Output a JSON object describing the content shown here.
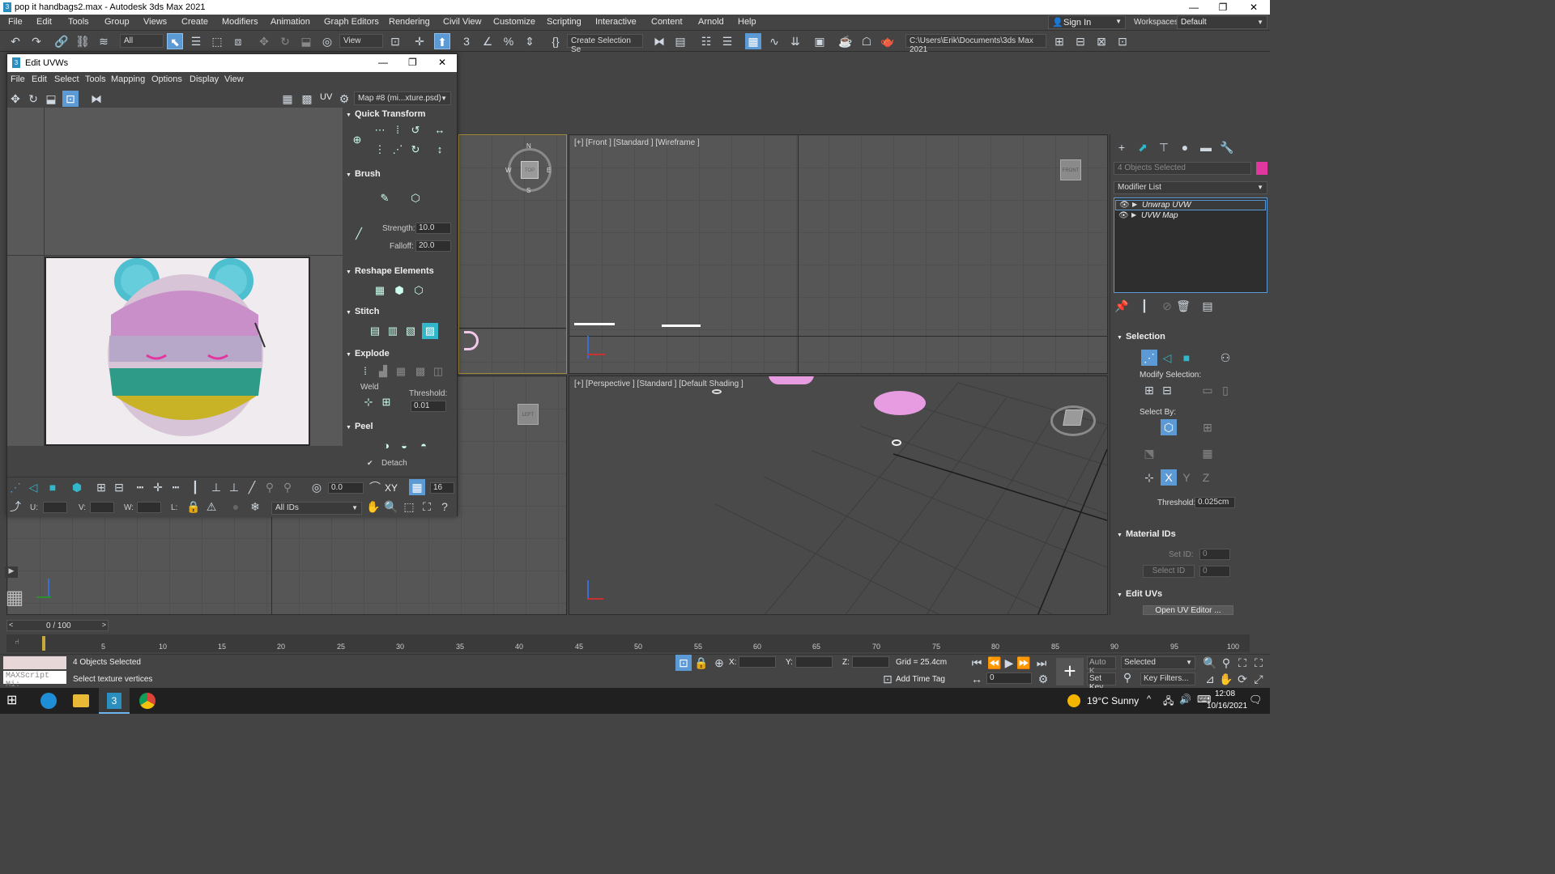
{
  "window": {
    "title": "pop it handbags2.max - Autodesk 3ds Max 2021",
    "icon": "3",
    "minimize": "—",
    "maximize": "❐",
    "close": "✕"
  },
  "menubar": {
    "items": [
      "File",
      "Edit",
      "Tools",
      "Group",
      "Views",
      "Create",
      "Modifiers",
      "Animation",
      "Graph Editors",
      "Rendering",
      "Civil View",
      "Customize",
      "Scripting",
      "Interactive",
      "Content",
      "Arnold",
      "Help"
    ],
    "sign_in": "Sign In",
    "workspaces_label": "Workspaces:",
    "workspaces_value": "Default"
  },
  "toolbar": {
    "filter_value": "All",
    "view_value": "View",
    "selection_set_value": "Create Selection Se",
    "path_value": "C:\\Users\\Erik\\Documents\\3ds Max 2021"
  },
  "uv_editor": {
    "title": "Edit UVWs",
    "icon": "3",
    "menu": [
      "File",
      "Edit",
      "Select",
      "Tools",
      "Mapping",
      "Options",
      "Display",
      "View"
    ],
    "uv_label": "UV",
    "map_dropdown": "Map #8 (mi...xture.psd)",
    "rollouts": {
      "quick_transform": "Quick Transform",
      "brush": "Brush",
      "strength_label": "Strength:",
      "strength_value": "10.0",
      "falloff_label": "Falloff:",
      "falloff_value": "20.0",
      "reshape": "Reshape Elements",
      "stitch": "Stitch",
      "explode": "Explode",
      "weld_label": "Weld",
      "threshold_label": "Threshold:",
      "threshold_value": "0.01",
      "peel": "Peel",
      "detach_label": "Detach"
    },
    "bottom": {
      "angle_value": "0.0",
      "xy_label": "XY",
      "grid_value": "16",
      "u_label": "U:",
      "v_label": "V:",
      "w_label": "W:",
      "l_label": "L:",
      "ids_value": "All IDs"
    }
  },
  "viewports": {
    "front_label": "[+] [Front ] [Standard ] [Wireframe ]",
    "perspective_label": "[+] [Perspective ] [Standard ] [Default Shading ]",
    "compass": {
      "n": "N",
      "s": "S",
      "e": "E",
      "w": "W",
      "top": "TOP"
    },
    "left_cube": "LEFT",
    "front_cube": "FRONT"
  },
  "command_panel": {
    "selected_text": "4 Objects Selected",
    "modifier_list": "Modifier List",
    "stack": [
      "Unwrap UVW",
      "UVW Map"
    ],
    "selection_title": "Selection",
    "modify_selection": "Modify Selection:",
    "select_by": "Select By:",
    "threshold_label": "Threshold:",
    "threshold_value": "0.025cm",
    "material_ids_title": "Material IDs",
    "set_id_label": "Set ID:",
    "set_id_value": "0",
    "select_id_label": "Select ID",
    "select_id_value": "0",
    "edit_uvs_title": "Edit UVs",
    "open_uv_editor": "Open UV Editor ..."
  },
  "timeline": {
    "frame_counter": "0 / 100",
    "ticks": [
      "0",
      "5",
      "10",
      "15",
      "20",
      "25",
      "30",
      "35",
      "40",
      "45",
      "50",
      "55",
      "60",
      "65",
      "70",
      "75",
      "80",
      "85",
      "90",
      "95",
      "100"
    ]
  },
  "status": {
    "maxscript": "MAXScript Mi:",
    "selected": "4 Objects Selected",
    "prompt": "Select texture vertices",
    "x_label": "X:",
    "y_label": "Y:",
    "z_label": "Z:",
    "grid": "Grid = 25.4cm",
    "add_time_tag": "Add Time Tag",
    "auto_key": "Auto K...",
    "selected_dropdown": "Selected",
    "set_key": "Set Key",
    "key_filters": "Key Filters...",
    "frame_value": "0"
  },
  "taskbar": {
    "weather": "19°C  Sunny",
    "time": "12:08",
    "date": "10/16/2021"
  },
  "colors": {
    "accent_cyan": "#31b7c9",
    "pink": "#e79be0",
    "highlight_blue": "#5c9ad6",
    "color_swatch": "#e0389f"
  }
}
